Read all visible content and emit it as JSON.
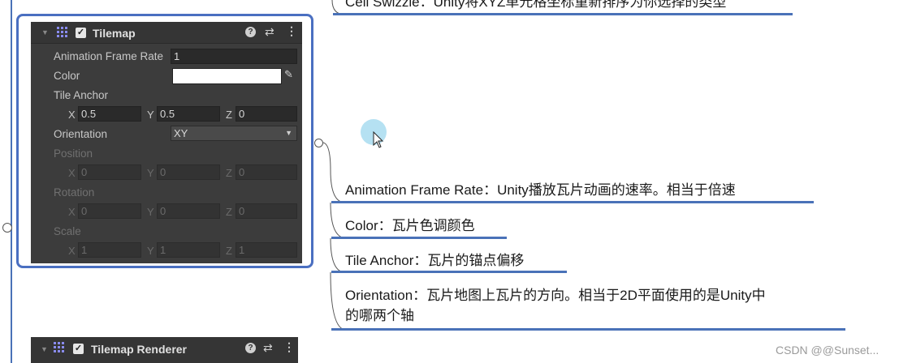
{
  "tilemap": {
    "title": "Tilemap",
    "fields": {
      "animation_frame_rate": {
        "label": "Animation Frame Rate",
        "value": "1"
      },
      "color": {
        "label": "Color",
        "value": "#ffffff"
      },
      "tile_anchor": {
        "label": "Tile Anchor",
        "x": "0.5",
        "y": "0.5",
        "z": "0"
      },
      "orientation": {
        "label": "Orientation",
        "value": "XY"
      },
      "position": {
        "label": "Position",
        "x": "0",
        "y": "0",
        "z": "0"
      },
      "rotation": {
        "label": "Rotation",
        "x": "0",
        "y": "0",
        "z": "0"
      },
      "scale": {
        "label": "Scale",
        "x": "1",
        "y": "1",
        "z": "1"
      }
    },
    "axis_labels": {
      "x": "X",
      "y": "Y",
      "z": "Z"
    }
  },
  "renderer": {
    "title": "Tilemap Renderer"
  },
  "notes": {
    "cell_swizzle": "Cell Swizzle：Unity将XYZ单元格坐标重新排序为你选择的类型",
    "animation_frame_rate": "Animation Frame Rate：Unity播放瓦片动画的速率。相当于倍速",
    "color": "Color：瓦片色调颜色",
    "tile_anchor": "Tile Anchor：瓦片的锚点偏移",
    "orientation_line1": "Orientation：瓦片地图上瓦片的方向。相当于2D平面使用的是Unity中",
    "orientation_line2": "的哪两个轴"
  },
  "watermark": "CSDN @@Sunset...",
  "colors": {
    "accent": "#4a72b8",
    "panel": "#3c3c3c",
    "cursor_highlight": "#a8dcf0"
  }
}
